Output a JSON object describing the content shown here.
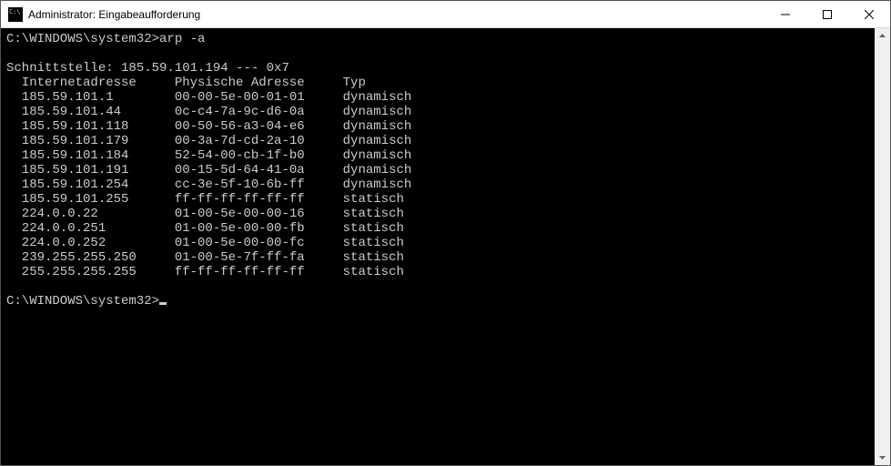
{
  "window": {
    "title": "Administrator: Eingabeaufforderung"
  },
  "terminal": {
    "prompt1": "C:\\WINDOWS\\system32>",
    "command1": "arp -a",
    "blank": "",
    "interface_line": "Schnittstelle: 185.59.101.194 --- 0x7",
    "header": {
      "col1": "  Internetadresse     Physische Adresse     Typ",
      "ip_label": "Internetadresse",
      "mac_label": "Physische Adresse",
      "type_label": "Typ"
    },
    "rows": [
      {
        "ip": "185.59.101.1",
        "mac": "00-00-5e-00-01-01",
        "type": "dynamisch"
      },
      {
        "ip": "185.59.101.44",
        "mac": "0c-c4-7a-9c-d6-0a",
        "type": "dynamisch"
      },
      {
        "ip": "185.59.101.118",
        "mac": "00-50-56-a3-04-e6",
        "type": "dynamisch"
      },
      {
        "ip": "185.59.101.179",
        "mac": "00-3a-7d-cd-2a-10",
        "type": "dynamisch"
      },
      {
        "ip": "185.59.101.184",
        "mac": "52-54-00-cb-1f-b0",
        "type": "dynamisch"
      },
      {
        "ip": "185.59.101.191",
        "mac": "00-15-5d-64-41-0a",
        "type": "dynamisch"
      },
      {
        "ip": "185.59.101.254",
        "mac": "cc-3e-5f-10-6b-ff",
        "type": "dynamisch"
      },
      {
        "ip": "185.59.101.255",
        "mac": "ff-ff-ff-ff-ff-ff",
        "type": "statisch"
      },
      {
        "ip": "224.0.0.22",
        "mac": "01-00-5e-00-00-16",
        "type": "statisch"
      },
      {
        "ip": "224.0.0.251",
        "mac": "01-00-5e-00-00-fb",
        "type": "statisch"
      },
      {
        "ip": "224.0.0.252",
        "mac": "01-00-5e-00-00-fc",
        "type": "statisch"
      },
      {
        "ip": "239.255.255.250",
        "mac": "01-00-5e-7f-ff-fa",
        "type": "statisch"
      },
      {
        "ip": "255.255.255.255",
        "mac": "ff-ff-ff-ff-ff-ff",
        "type": "statisch"
      }
    ],
    "prompt2": "C:\\WINDOWS\\system32>"
  }
}
